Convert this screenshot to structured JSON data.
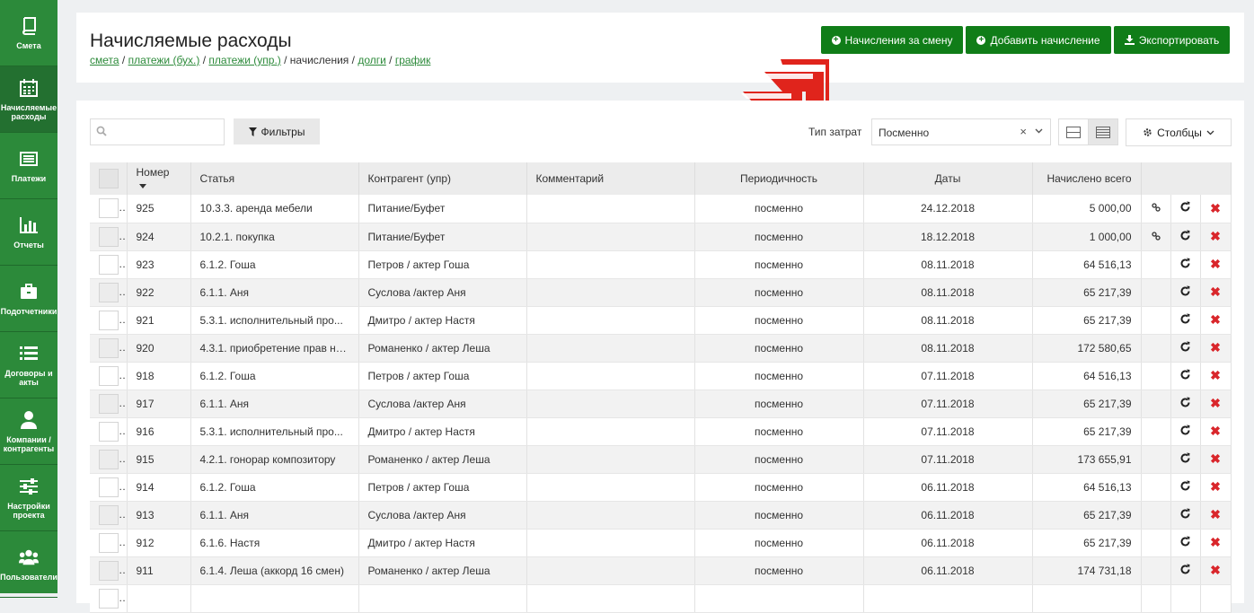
{
  "sidebar": {
    "items": [
      {
        "label": "Смета",
        "icon": "book-icon"
      },
      {
        "label": "Начисляемые расходы",
        "icon": "calendar-icon"
      },
      {
        "label": "Платежи",
        "icon": "list-alt-icon"
      },
      {
        "label": "Отчеты",
        "icon": "bar-chart-icon"
      },
      {
        "label": "Подотчетники",
        "icon": "briefcase-icon"
      },
      {
        "label": "Договоры и акты",
        "icon": "list-icon"
      },
      {
        "label": "Компании / контрагенты",
        "icon": "user-icon"
      },
      {
        "label": "Настройки проекта",
        "icon": "sliders-icon"
      },
      {
        "label": "Пользователи",
        "icon": "users-icon"
      }
    ]
  },
  "header": {
    "title": "Начисляемые расходы",
    "breadcrumb": {
      "smeta": "смета",
      "sep": " / ",
      "payments_acc": "платежи (бух.)",
      "payments_mgmt": "платежи (упр.)",
      "current": "начисления",
      "debts": "долги",
      "chart": "график"
    },
    "buttons": {
      "shift": "Начисления за смену",
      "add": "Добавить начисление",
      "export": "Экспортировать"
    }
  },
  "toolbar": {
    "search_placeholder": "",
    "filters": "Фильтры",
    "type_label": "Тип затрат",
    "type_value": "Посменно",
    "columns": "Столбцы"
  },
  "table": {
    "headers": {
      "number": "Номер",
      "article": "Статья",
      "counterparty": "Контрагент (упр)",
      "comment": "Комментарий",
      "periodicity": "Периодичность",
      "dates": "Даты",
      "total": "Начислено всего"
    },
    "rows": [
      {
        "num": "925",
        "article": "10.3.3. аренда мебели",
        "cp": "Питание/Буфет",
        "comment": "",
        "period": "посменно",
        "date": "24.12.2018",
        "total": "5 000,00",
        "link": true
      },
      {
        "num": "924",
        "article": "10.2.1. покупка",
        "cp": "Питание/Буфет",
        "comment": "",
        "period": "посменно",
        "date": "18.12.2018",
        "total": "1 000,00",
        "link": true
      },
      {
        "num": "923",
        "article": "6.1.2. Гоша",
        "cp": "Петров / актер Гоша",
        "comment": "",
        "period": "посменно",
        "date": "08.11.2018",
        "total": "64 516,13",
        "link": false
      },
      {
        "num": "922",
        "article": "6.1.1. Аня",
        "cp": "Суслова /актер Аня",
        "comment": "",
        "period": "посменно",
        "date": "08.11.2018",
        "total": "65 217,39",
        "link": false
      },
      {
        "num": "921",
        "article": "5.3.1. исполнительный про...",
        "cp": "Дмитро / актер Настя",
        "comment": "",
        "period": "посменно",
        "date": "08.11.2018",
        "total": "65 217,39",
        "link": false
      },
      {
        "num": "920",
        "article": "4.3.1. приобретение прав на...",
        "cp": "Романенко / актер Леша",
        "comment": "",
        "period": "посменно",
        "date": "08.11.2018",
        "total": "172 580,65",
        "link": false
      },
      {
        "num": "918",
        "article": "6.1.2. Гоша",
        "cp": "Петров / актер Гоша",
        "comment": "",
        "period": "посменно",
        "date": "07.11.2018",
        "total": "64 516,13",
        "link": false
      },
      {
        "num": "917",
        "article": "6.1.1. Аня",
        "cp": "Суслова /актер Аня",
        "comment": "",
        "period": "посменно",
        "date": "07.11.2018",
        "total": "65 217,39",
        "link": false
      },
      {
        "num": "916",
        "article": "5.3.1. исполнительный про...",
        "cp": "Дмитро / актер Настя",
        "comment": "",
        "period": "посменно",
        "date": "07.11.2018",
        "total": "65 217,39",
        "link": false
      },
      {
        "num": "915",
        "article": "4.2.1. гонорар композитору",
        "cp": "Романенко / актер Леша",
        "comment": "",
        "period": "посменно",
        "date": "07.11.2018",
        "total": "173 655,91",
        "link": false
      },
      {
        "num": "914",
        "article": "6.1.2. Гоша",
        "cp": "Петров / актер Гоша",
        "comment": "",
        "period": "посменно",
        "date": "06.11.2018",
        "total": "64 516,13",
        "link": false
      },
      {
        "num": "913",
        "article": "6.1.1. Аня",
        "cp": "Суслова /актер Аня",
        "comment": "",
        "period": "посменно",
        "date": "06.11.2018",
        "total": "65 217,39",
        "link": false
      },
      {
        "num": "912",
        "article": "6.1.6. Настя",
        "cp": "Дмитро / актер Настя",
        "comment": "",
        "period": "посменно",
        "date": "06.11.2018",
        "total": "65 217,39",
        "link": false
      },
      {
        "num": "911",
        "article": "6.1.4. Леша (аккорд 16 смен)",
        "cp": "Романенко / актер Леша",
        "comment": "",
        "period": "посменно",
        "date": "06.11.2018",
        "total": "174 731,18",
        "link": false
      },
      {
        "num": "",
        "article": "",
        "cp": "",
        "comment": "",
        "period": "",
        "date": "",
        "total": "",
        "link": false
      }
    ]
  },
  "colors": {
    "sidebar": "#2c8a3a",
    "button": "#107d18",
    "delete": "#d9262b",
    "logo": "#e0241c"
  }
}
